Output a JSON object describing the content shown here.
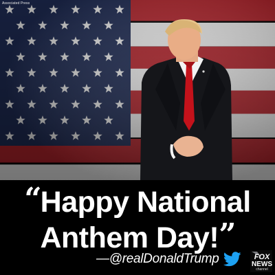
{
  "photo_credit": "Associated Press",
  "quote": {
    "open_mark": "“",
    "line1": "Happy National",
    "line2": "Anthem Day!",
    "close_mark": "”"
  },
  "attribution": {
    "handle": "—@realDonaldTrump",
    "icon": "twitter-bird-icon"
  },
  "network_logo": {
    "icon": "fox-news-logo",
    "text": [
      "FOX",
      "NEWS",
      "channel"
    ]
  },
  "colors": {
    "flag_red": "#b3242c",
    "flag_blue": "#1f2c55",
    "twitter_blue": "#1da1f2",
    "background": "#000000",
    "text": "#ffffff"
  }
}
